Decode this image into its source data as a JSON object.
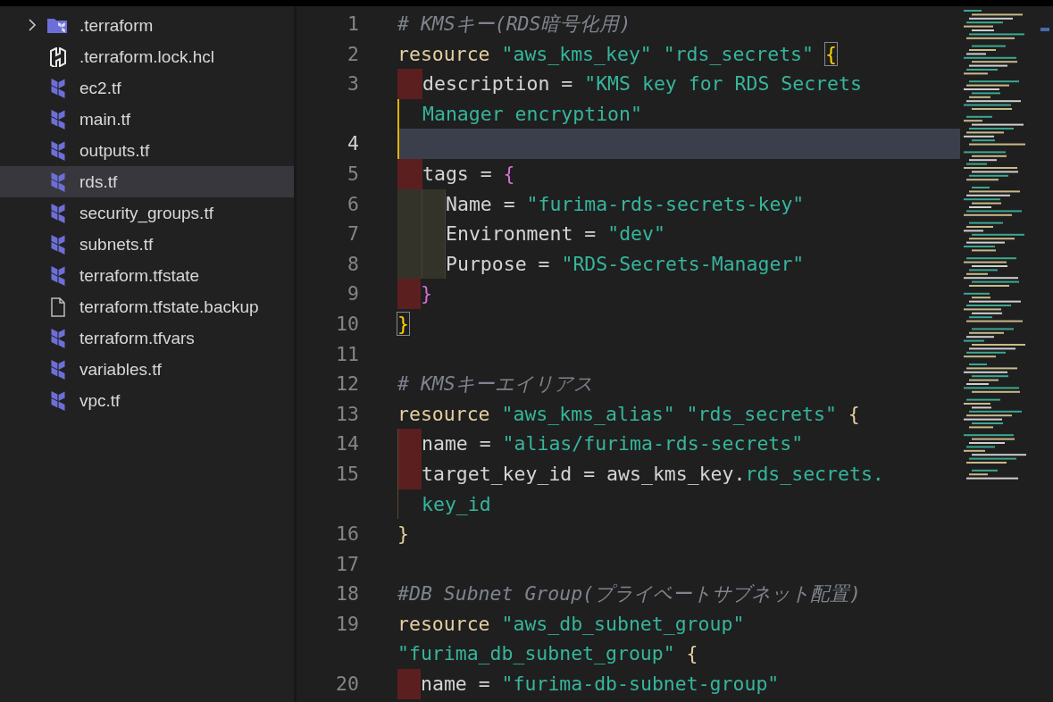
{
  "sidebar": {
    "items": [
      {
        "kind": "folder",
        "label": ".terraform",
        "expanded": false,
        "selected": false
      },
      {
        "kind": "hcl",
        "label": ".terraform.lock.hcl",
        "selected": false
      },
      {
        "kind": "terraform",
        "label": "ec2.tf",
        "selected": false
      },
      {
        "kind": "terraform",
        "label": "main.tf",
        "selected": false
      },
      {
        "kind": "terraform",
        "label": "outputs.tf",
        "selected": false
      },
      {
        "kind": "terraform",
        "label": "rds.tf",
        "selected": true
      },
      {
        "kind": "terraform",
        "label": "security_groups.tf",
        "selected": false
      },
      {
        "kind": "terraform",
        "label": "subnets.tf",
        "selected": false
      },
      {
        "kind": "terraform",
        "label": "terraform.tfstate",
        "selected": false
      },
      {
        "kind": "file",
        "label": "terraform.tfstate.backup",
        "selected": false
      },
      {
        "kind": "terraform",
        "label": "terraform.tfvars",
        "selected": false
      },
      {
        "kind": "terraform",
        "label": "variables.tf",
        "selected": false
      },
      {
        "kind": "terraform",
        "label": "vpc.tf",
        "selected": false
      }
    ]
  },
  "editor": {
    "rows": [
      {
        "number": "1",
        "current": false,
        "tokens": [
          {
            "kind": "comment",
            "text": "# KMSキー(RDS暗号化用)"
          }
        ]
      },
      {
        "number": "2",
        "current": false,
        "tokens": [
          {
            "kind": "keyword",
            "text": "resource "
          },
          {
            "kind": "string",
            "text": "\"aws_kms_key\" \"rds_secrets\" "
          },
          {
            "kind": "brace_yellow",
            "text": "{",
            "matched": true
          }
        ]
      },
      {
        "number": "3",
        "current": false,
        "guide_active": true,
        "indent": [
          {
            "kind": "error"
          }
        ],
        "tokens": [
          {
            "kind": "text",
            "text": "description = "
          },
          {
            "kind": "string",
            "text": "\"KMS key for RDS Secrets"
          }
        ]
      },
      {
        "current": false,
        "guide_active": true,
        "indent": [
          {
            "kind": "none"
          }
        ],
        "tokens": [
          {
            "kind": "string",
            "text": "Manager encryption\""
          }
        ]
      },
      {
        "number": "4",
        "current": true,
        "guide_active": true,
        "tokens": []
      },
      {
        "number": "5",
        "current": false,
        "guide_active": true,
        "indent": [
          {
            "kind": "error"
          }
        ],
        "tokens": [
          {
            "kind": "text",
            "text": "tags = "
          },
          {
            "kind": "brace_pink",
            "text": "{"
          }
        ]
      },
      {
        "number": "6",
        "current": false,
        "guide_active": true,
        "indent": [
          {
            "kind": "olive"
          },
          {
            "kind": "olive"
          }
        ],
        "tokens": [
          {
            "kind": "text",
            "text": "Name = "
          },
          {
            "kind": "string",
            "text": "\"furima-rds-secrets-key\""
          }
        ]
      },
      {
        "number": "7",
        "current": false,
        "guide_active": true,
        "indent": [
          {
            "kind": "olive"
          },
          {
            "kind": "olive"
          }
        ],
        "tokens": [
          {
            "kind": "text",
            "text": "Environment = "
          },
          {
            "kind": "string",
            "text": "\"dev\""
          }
        ]
      },
      {
        "number": "8",
        "current": false,
        "guide_active": true,
        "indent": [
          {
            "kind": "olive"
          },
          {
            "kind": "olive"
          }
        ],
        "tokens": [
          {
            "kind": "text",
            "text": "Purpose = "
          },
          {
            "kind": "string",
            "text": "\"RDS-Secrets-Manager\""
          }
        ]
      },
      {
        "number": "9",
        "current": false,
        "indent": [
          {
            "kind": "error"
          }
        ],
        "tokens": [
          {
            "kind": "brace_pink",
            "text": "}"
          }
        ]
      },
      {
        "number": "10",
        "current": false,
        "tokens": [
          {
            "kind": "brace_yellow",
            "text": "}",
            "matched": true
          }
        ]
      },
      {
        "number": "11",
        "current": false,
        "tokens": []
      },
      {
        "number": "12",
        "current": false,
        "tokens": [
          {
            "kind": "comment",
            "text": "# KMSキーエイリアス"
          }
        ]
      },
      {
        "number": "13",
        "current": false,
        "tokens": [
          {
            "kind": "keyword",
            "text": "resource "
          },
          {
            "kind": "string",
            "text": "\"aws_kms_alias\" \"rds_secrets\" "
          },
          {
            "kind": "punct",
            "text": "{"
          }
        ]
      },
      {
        "number": "14",
        "current": false,
        "guide_active": false,
        "indent": [
          {
            "kind": "error"
          }
        ],
        "tokens": [
          {
            "kind": "text",
            "text": "name = "
          },
          {
            "kind": "string",
            "text": "\"alias/furima-rds-secrets\""
          }
        ]
      },
      {
        "number": "15",
        "current": false,
        "guide_active": false,
        "indent": [
          {
            "kind": "error"
          }
        ],
        "tokens": [
          {
            "kind": "text",
            "text": "target_key_id = aws_kms_key."
          },
          {
            "kind": "string",
            "text": "rds_secrets."
          }
        ]
      },
      {
        "current": false,
        "guide_active": false,
        "indent": [
          {
            "kind": "none"
          }
        ],
        "tokens": [
          {
            "kind": "string",
            "text": "key_id"
          }
        ]
      },
      {
        "number": "16",
        "current": false,
        "tokens": [
          {
            "kind": "punct",
            "text": "}"
          }
        ]
      },
      {
        "number": "17",
        "current": false,
        "tokens": []
      },
      {
        "number": "18",
        "current": false,
        "tokens": [
          {
            "kind": "comment",
            "text": "#DB Subnet Group(プライベートサブネット配置)"
          }
        ]
      },
      {
        "number": "19",
        "current": false,
        "tokens": [
          {
            "kind": "keyword",
            "text": "resource "
          },
          {
            "kind": "string",
            "text": "\"aws_db_subnet_group\""
          }
        ]
      },
      {
        "current": false,
        "tokens": [
          {
            "kind": "string",
            "text": "\"furima_db_subnet_group\" "
          },
          {
            "kind": "punct",
            "text": "{"
          }
        ]
      },
      {
        "number": "20",
        "current": false,
        "indent": [
          {
            "kind": "error"
          }
        ],
        "tokens": [
          {
            "kind": "text",
            "text": "name = "
          },
          {
            "kind": "string",
            "text": "\"furima-db-subnet-group\""
          }
        ]
      }
    ]
  }
}
